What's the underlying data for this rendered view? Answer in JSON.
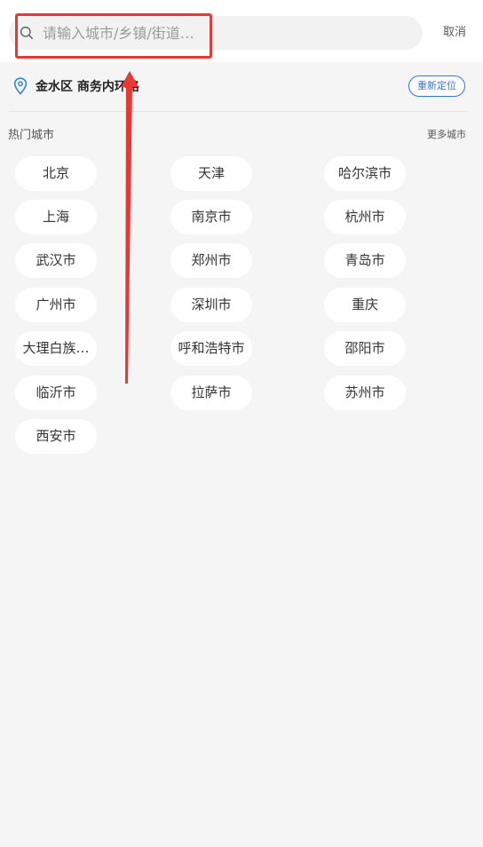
{
  "search": {
    "placeholder": "请输入城市/乡镇/街道…",
    "value": "",
    "icon": "search-icon"
  },
  "header": {
    "cancel_label": "取消"
  },
  "location": {
    "icon": "map-pin-icon",
    "text": "金水区 商务内环路",
    "relocate_label": "重新定位"
  },
  "hot_cities": {
    "title": "热门城市",
    "more_label": "更多城市",
    "items": [
      "北京",
      "天津",
      "哈尔滨市",
      "上海",
      "南京市",
      "杭州市",
      "武汉市",
      "郑州市",
      "青岛市",
      "广州市",
      "深圳市",
      "重庆",
      "大理白族…",
      "呼和浩特市",
      "邵阳市",
      "临沂市",
      "拉萨市",
      "苏州市",
      "西安市"
    ]
  },
  "colors": {
    "accent": "#2f74e3",
    "annotation": "#e53935",
    "background": "#f5f5f6"
  }
}
